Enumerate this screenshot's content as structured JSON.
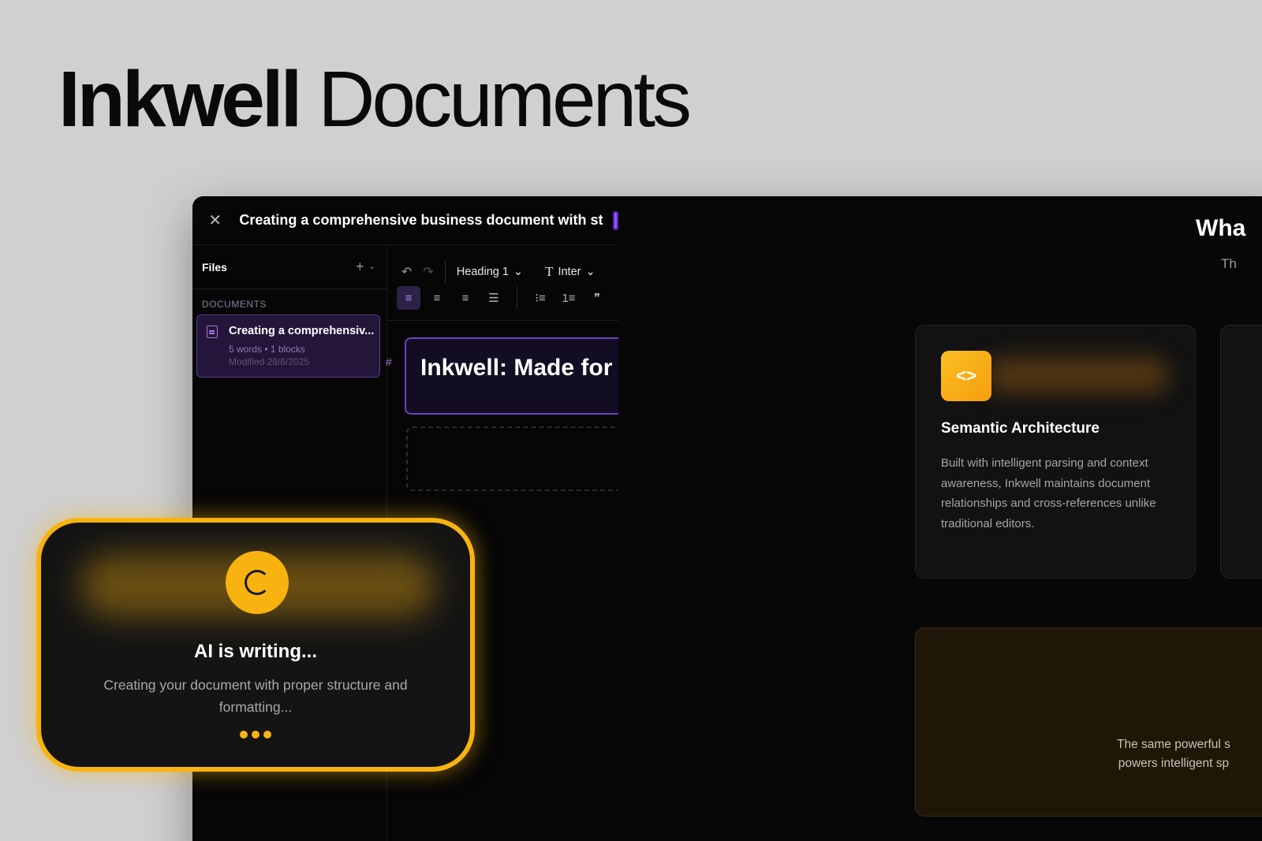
{
  "hero": {
    "brand": "Inkwell",
    "suffix": "Documents"
  },
  "editor": {
    "title": "Creating a comprehensive business document with st",
    "sidebar": {
      "title": "Files",
      "add_icon": "plus-icon",
      "section_label": "DOCUMENTS",
      "documents": [
        {
          "name": "Creating a comprehensiv...",
          "meta": "5 words • 1 blocks",
          "modified": "Modified 28/6/2025"
        }
      ]
    },
    "toolbar": {
      "heading_select": "Heading 1",
      "font_select": "Inter"
    },
    "content": {
      "heading_marker": "#",
      "heading_text": "Inkwell: Made for"
    }
  },
  "preview": {
    "heading": "Wha",
    "subheading": "Th",
    "feature": {
      "icon": "code-icon",
      "title": "Semantic Architecture",
      "description": "Built with intelligent parsing and context awareness, Inkwell maintains document relationships and cross-references unlike traditional editors."
    },
    "bottom_text_line1": "The same powerful s",
    "bottom_text_line2": "powers intelligent sp"
  },
  "ai_overlay": {
    "title": "AI is writing...",
    "description": "Creating your document with proper structure and formatting..."
  },
  "colors": {
    "accent_purple": "#8b5cf6",
    "accent_amber": "#f9b310"
  }
}
